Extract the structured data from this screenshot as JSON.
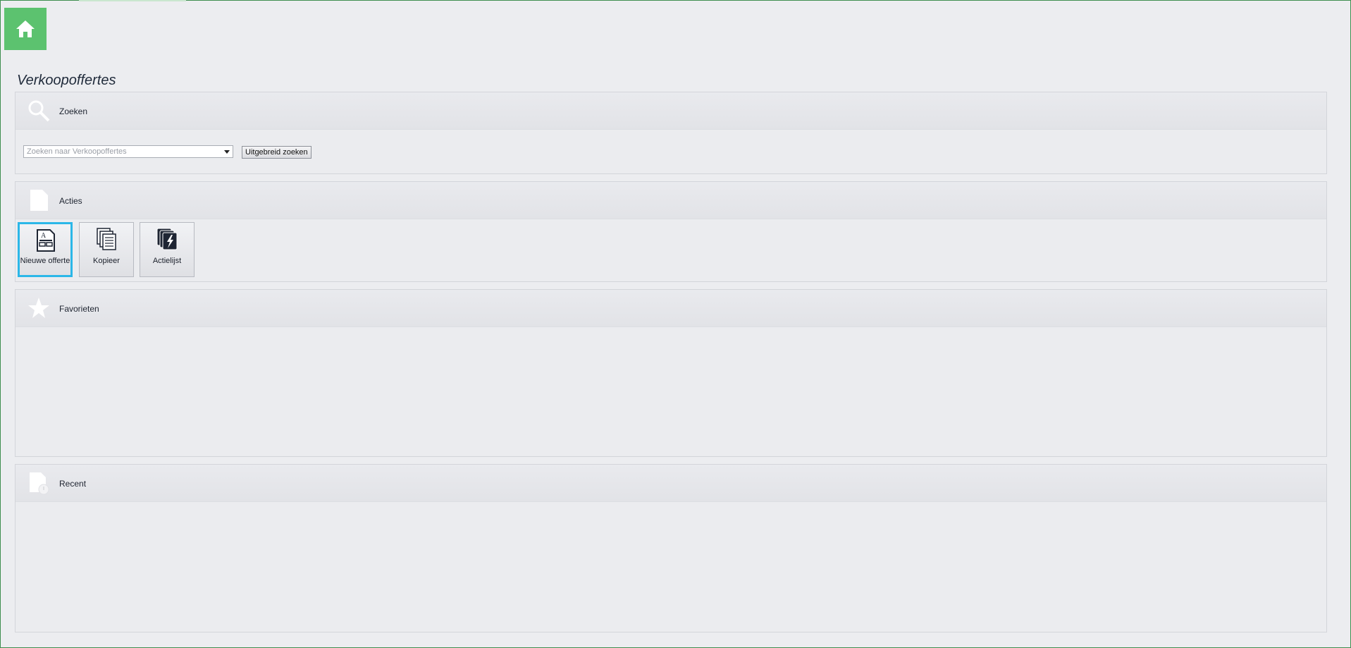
{
  "page": {
    "title": "Verkoopoffertes"
  },
  "home": {
    "icon": "home-icon",
    "color": "#5cc26f"
  },
  "search": {
    "title": "Zoeken",
    "icon": "search-icon",
    "placeholder": "Zoeken naar Verkoopoffertes",
    "advanced_label": "Uitgebreid zoeken"
  },
  "actions": {
    "title": "Acties",
    "icon": "document-icon",
    "items": [
      {
        "label": "Nieuwe offerte",
        "icon": "new-quote-icon",
        "selected": true
      },
      {
        "label": "Kopieer",
        "icon": "copy-icon",
        "selected": false
      },
      {
        "label": "Actielijst",
        "icon": "action-list-icon",
        "selected": false
      }
    ],
    "selected_border_color": "#2bb7e8"
  },
  "favorites": {
    "title": "Favorieten",
    "icon": "star-icon"
  },
  "recent": {
    "title": "Recent",
    "icon": "recent-document-icon"
  }
}
